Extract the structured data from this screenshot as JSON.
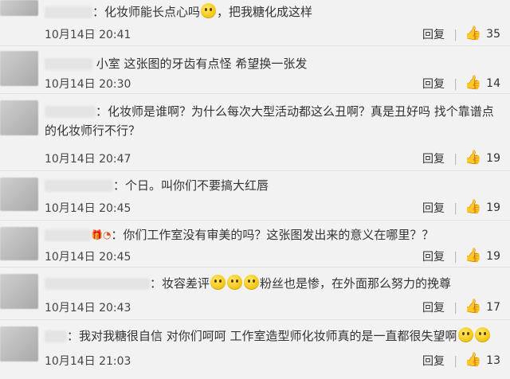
{
  "comments": [
    {
      "pre": "：化妆师能长点心吗",
      "emojis": 1,
      "post": "，把我糖化成这样",
      "time": "10月14日 20:41",
      "reply": "回复",
      "likes": "35"
    },
    {
      "pre": "小室 这张图的牙齿有点怪 希望换一张发",
      "emojis": 0,
      "post": "",
      "time": "10月14日 20:30",
      "reply": "回复",
      "likes": "14"
    },
    {
      "pre": "：化妆师是谁啊？为什么每次大型活动都这么丑啊？真是丑好吗 找个靠谱点的化妆师行不行？",
      "emojis": 0,
      "post": "",
      "time": "10月14日 20:47",
      "reply": "回复",
      "likes": "19"
    },
    {
      "pre": "：个日。叫你们不要搞大红唇",
      "emojis": 0,
      "post": "",
      "time": "10月14日 20:45",
      "reply": "回复",
      "likes": "19"
    },
    {
      "pre": "：你们工作室没有审美的吗？这张图发出来的意义在哪里？？",
      "emojis": 0,
      "post": "",
      "time": "10月14日 20:45",
      "reply": "回复",
      "likes": "19"
    },
    {
      "pre": "：妆容差评",
      "emojis": 3,
      "post": "粉丝也是惨，在外面那么努力的挽尊",
      "time": "10月14日 20:43",
      "reply": "回复",
      "likes": "17"
    },
    {
      "pre": "：我对我糖很自信 对你们呵呵 工作室造型师化妆师真的是一直都很失望啊",
      "emojis": 2,
      "post": "",
      "time": "10月14日 21:03",
      "reply": "回复",
      "likes": "13"
    }
  ]
}
